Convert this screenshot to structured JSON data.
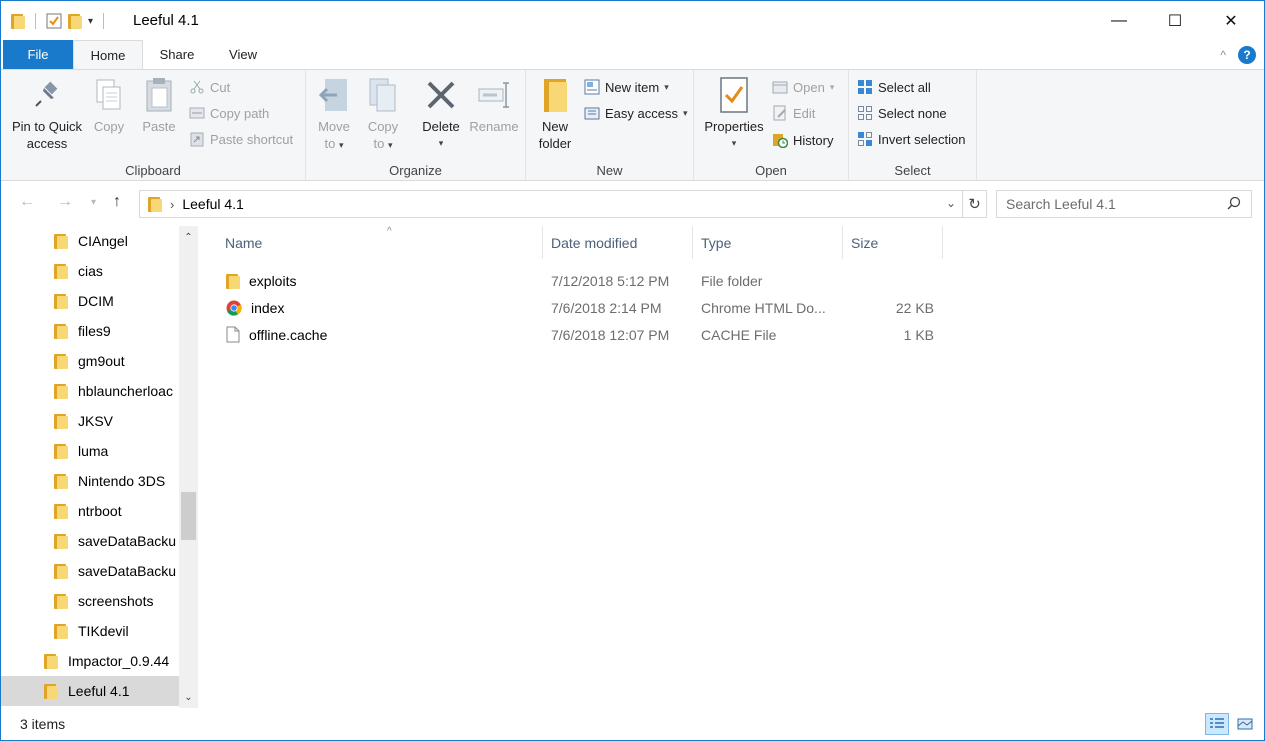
{
  "window": {
    "title": "Leeful 4.1",
    "minimize_glyph": "—",
    "maximize_glyph": "☐",
    "close_glyph": "✕"
  },
  "ribbon_tabs": [
    "File",
    "Home",
    "Share",
    "View"
  ],
  "help_glyph": "?",
  "collapse_glyph": "^",
  "ribbon": {
    "clipboard": {
      "label": "Clipboard",
      "pin_line1": "Pin to Quick",
      "pin_line2": "access",
      "copy": "Copy",
      "paste": "Paste",
      "cut": "Cut",
      "copy_path": "Copy path",
      "paste_shortcut": "Paste shortcut"
    },
    "organize": {
      "label": "Organize",
      "move_to_line1": "Move",
      "move_to_line2": "to",
      "copy_to_line1": "Copy",
      "copy_to_line2": "to",
      "delete": "Delete",
      "rename": "Rename"
    },
    "new": {
      "label": "New",
      "new_folder_line1": "New",
      "new_folder_line2": "folder",
      "new_item": "New item",
      "easy_access": "Easy access"
    },
    "open": {
      "label": "Open",
      "properties": "Properties",
      "open": "Open",
      "edit": "Edit",
      "history": "History"
    },
    "select": {
      "label": "Select",
      "select_all": "Select all",
      "select_none": "Select none",
      "invert_selection": "Invert selection"
    }
  },
  "address": {
    "path": "Leeful 4.1",
    "search_placeholder": "Search Leeful 4.1"
  },
  "nav_tree": [
    {
      "label": "CIAngel",
      "indent": 1
    },
    {
      "label": "cias",
      "indent": 1
    },
    {
      "label": "DCIM",
      "indent": 1
    },
    {
      "label": "files9",
      "indent": 1
    },
    {
      "label": "gm9out",
      "indent": 1
    },
    {
      "label": "hblauncherloac",
      "indent": 1
    },
    {
      "label": "JKSV",
      "indent": 1
    },
    {
      "label": "luma",
      "indent": 1
    },
    {
      "label": "Nintendo 3DS",
      "indent": 1
    },
    {
      "label": "ntrboot",
      "indent": 1
    },
    {
      "label": "saveDataBacku",
      "indent": 1
    },
    {
      "label": "saveDataBacku",
      "indent": 1
    },
    {
      "label": "screenshots",
      "indent": 1
    },
    {
      "label": "TIKdevil",
      "indent": 1
    },
    {
      "label": "Impactor_0.9.44",
      "indent": 0
    },
    {
      "label": "Leeful 4.1",
      "indent": 0,
      "selected": true
    }
  ],
  "columns": {
    "name": "Name",
    "date_modified": "Date modified",
    "type": "Type",
    "size": "Size"
  },
  "files": [
    {
      "icon": "folder-icon",
      "name": "exploits",
      "date": "7/12/2018 5:12 PM",
      "type": "File folder",
      "size": ""
    },
    {
      "icon": "chrome-icon",
      "name": "index",
      "date": "7/6/2018 2:14 PM",
      "type": "Chrome HTML Do...",
      "size": "22 KB"
    },
    {
      "icon": "file-icon",
      "name": "offline.cache",
      "date": "7/6/2018 12:07 PM",
      "type": "CACHE File",
      "size": "1 KB"
    }
  ],
  "status": {
    "item_count": "3 items"
  },
  "colors": {
    "accent": "#1979ca",
    "ribbon_bg": "#f5f6f7",
    "selected_bg": "#d9d9d9",
    "header_text": "#4c607a",
    "muted_text": "#6d6d6d"
  }
}
